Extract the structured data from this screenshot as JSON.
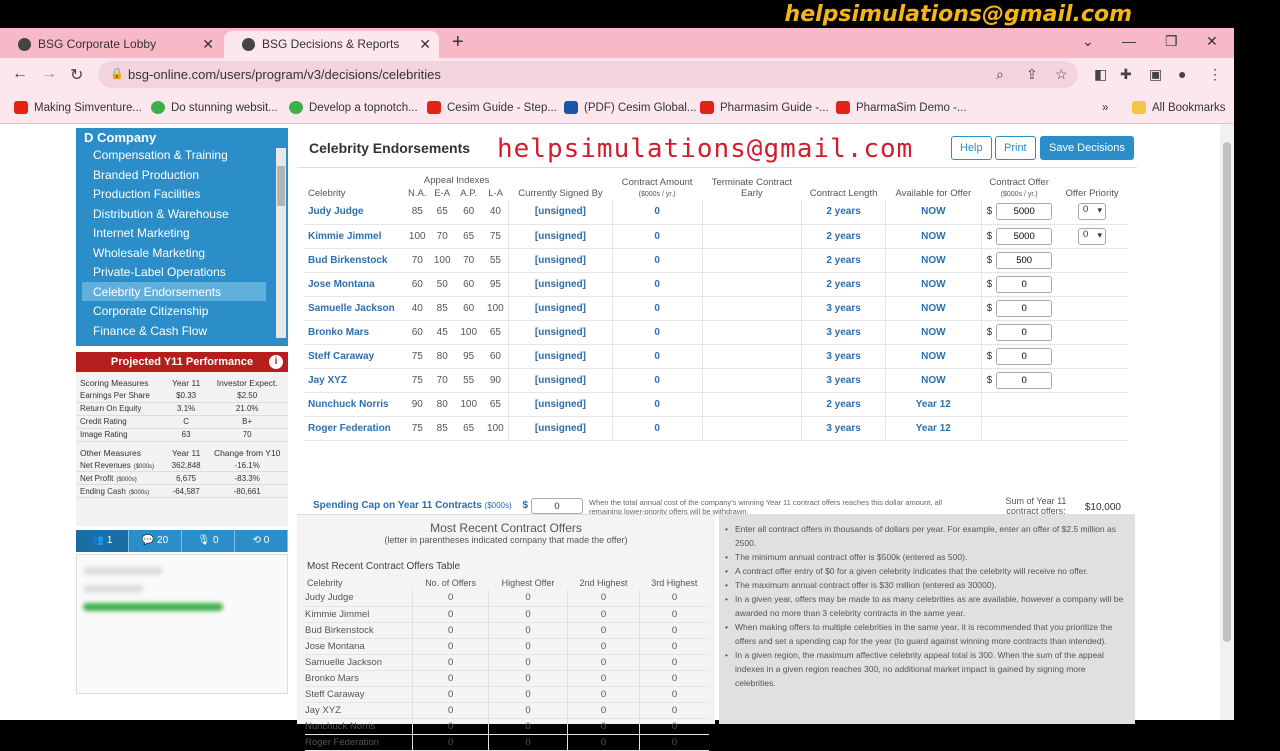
{
  "watermark_top": "helpsimulations@gmail.com",
  "watermark_mid": "helpsimulations@gmail.com",
  "browser": {
    "tabs": [
      {
        "title": "BSG Corporate Lobby"
      },
      {
        "title": "BSG Decisions & Reports"
      }
    ],
    "url": "bsg-online.com/users/program/v3/decisions/celebrities",
    "bookmarks": [
      {
        "label": "Making Simventure...",
        "icon": "youtube"
      },
      {
        "label": "Do stunning websit...",
        "icon": "green"
      },
      {
        "label": "Develop a topnotch...",
        "icon": "green"
      },
      {
        "label": "Cesim Guide - Step...",
        "icon": "youtube"
      },
      {
        "label": "(PDF) Cesim Global...",
        "icon": "doc"
      },
      {
        "label": "Pharmasim Guide -...",
        "icon": "youtube"
      },
      {
        "label": "PharmaSim Demo -...",
        "icon": "youtube"
      }
    ],
    "all_bookmarks": "All Bookmarks"
  },
  "sidebar": {
    "company": "D Company",
    "items": [
      "Compensation & Training",
      "Branded Production",
      "Production Facilities",
      "Distribution & Warehouse",
      "Internet Marketing",
      "Wholesale Marketing",
      "Private-Label Operations",
      "Celebrity Endorsements",
      "Corporate Citizenship",
      "Finance & Cash Flow"
    ],
    "active_index": 7
  },
  "performance": {
    "title": "Projected Y11 Performance",
    "scoring_header": [
      "Scoring Measures",
      "Year 11",
      "Investor Expect."
    ],
    "scoring": [
      [
        "Earnings Per Share",
        "$0.33",
        "$2.50"
      ],
      [
        "Return On Equity",
        "3.1%",
        "21.0%"
      ],
      [
        "Credit Rating",
        "C",
        "B+"
      ],
      [
        "Image Rating",
        "63",
        "70"
      ]
    ],
    "other_header": [
      "Other Measures",
      "Year 11",
      "Change from Y10"
    ],
    "other": [
      [
        "Net Revenues",
        "($000s)",
        "362,848",
        "-16.1%"
      ],
      [
        "Net Profit",
        "($000s)",
        "6,675",
        "-83.3%"
      ],
      [
        "Ending Cash",
        "($000s)",
        "-64,587",
        "-80,661"
      ]
    ]
  },
  "side_tabs": [
    "1",
    "20",
    "0",
    "0"
  ],
  "main": {
    "title": "Celebrity Endorsements",
    "buttons": {
      "help": "Help",
      "print": "Print",
      "save": "Save Decisions"
    },
    "headers": {
      "celebrity": "Celebrity",
      "appeal": "Appeal Indexes",
      "na": "N.A.",
      "ea": "E-A",
      "ap": "A.P.",
      "la": "L-A",
      "signed": "Currently Signed By",
      "contract_amount": "Contract Amount",
      "contract_amount_unit": "($000s / yr.)",
      "terminate": "Terminate Contract Early",
      "length": "Contract Length",
      "available": "Available for Offer",
      "offer": "Contract Offer",
      "offer_unit": "($000s / yr.)",
      "priority": "Offer Priority"
    },
    "celebrities": [
      {
        "name": "Judy Judge",
        "na": "85",
        "ea": "65",
        "ap": "60",
        "la": "40",
        "signed": "[unsigned]",
        "amount": "0",
        "length": "2 years",
        "available": "NOW",
        "offer": "5000",
        "priority": "0"
      },
      {
        "name": "Kimmie Jimmel",
        "na": "100",
        "ea": "70",
        "ap": "65",
        "la": "75",
        "signed": "[unsigned]",
        "amount": "0",
        "length": "2 years",
        "available": "NOW",
        "offer": "5000",
        "priority": "0"
      },
      {
        "name": "Bud Birkenstock",
        "na": "70",
        "ea": "100",
        "ap": "70",
        "la": "55",
        "signed": "[unsigned]",
        "amount": "0",
        "length": "2 years",
        "available": "NOW",
        "offer": "500",
        "priority": ""
      },
      {
        "name": "Jose Montana",
        "na": "60",
        "ea": "50",
        "ap": "60",
        "la": "95",
        "signed": "[unsigned]",
        "amount": "0",
        "length": "2 years",
        "available": "NOW",
        "offer": "0",
        "priority": ""
      },
      {
        "name": "Samuelle Jackson",
        "na": "40",
        "ea": "85",
        "ap": "60",
        "la": "100",
        "signed": "[unsigned]",
        "amount": "0",
        "length": "3 years",
        "available": "NOW",
        "offer": "0",
        "priority": ""
      },
      {
        "name": "Bronko Mars",
        "na": "60",
        "ea": "45",
        "ap": "100",
        "la": "65",
        "signed": "[unsigned]",
        "amount": "0",
        "length": "3 years",
        "available": "NOW",
        "offer": "0",
        "priority": ""
      },
      {
        "name": "Steff Caraway",
        "na": "75",
        "ea": "80",
        "ap": "95",
        "la": "60",
        "signed": "[unsigned]",
        "amount": "0",
        "length": "3 years",
        "available": "NOW",
        "offer": "0",
        "priority": ""
      },
      {
        "name": "Jay XYZ",
        "na": "75",
        "ea": "70",
        "ap": "55",
        "la": "90",
        "signed": "[unsigned]",
        "amount": "0",
        "length": "3 years",
        "available": "NOW",
        "offer": "0",
        "priority": ""
      },
      {
        "name": "Nunchuck Norris",
        "na": "90",
        "ea": "80",
        "ap": "100",
        "la": "65",
        "signed": "[unsigned]",
        "amount": "0",
        "length": "2 years",
        "available": "Year 12",
        "offer": "",
        "priority": ""
      },
      {
        "name": "Roger Federation",
        "na": "75",
        "ea": "85",
        "ap": "65",
        "la": "100",
        "signed": "[unsigned]",
        "amount": "0",
        "length": "3 years",
        "available": "Year 12",
        "offer": "",
        "priority": ""
      }
    ],
    "spending_cap": {
      "label": "Spending Cap on Year 11 Contracts",
      "unit": "($000s)",
      "currency": "$",
      "value": "0",
      "note": "When the total annual cost of the company's winning Year 11 contract offers reaches this dollar amount, all remaining lower-priority offers will be withdrawn.",
      "sum_label": "Sum of Year 11 contract offers:",
      "sum_value": "$10,000"
    },
    "recent": {
      "title": "Most Recent Contract Offers",
      "subtitle": "(letter in parentheses indicated company that made the offer)",
      "table_title": "Most Recent Contract Offers Table",
      "headers": [
        "Celebrity",
        "No. of Offers",
        "Highest Offer",
        "2nd Highest",
        "3rd Highest"
      ],
      "rows": [
        [
          "Judy Judge",
          "0",
          "0",
          "0",
          "0"
        ],
        [
          "Kimmie Jimmel",
          "0",
          "0",
          "0",
          "0"
        ],
        [
          "Bud Birkenstock",
          "0",
          "0",
          "0",
          "0"
        ],
        [
          "Jose Montana",
          "0",
          "0",
          "0",
          "0"
        ],
        [
          "Samuelle Jackson",
          "0",
          "0",
          "0",
          "0"
        ],
        [
          "Bronko Mars",
          "0",
          "0",
          "0",
          "0"
        ],
        [
          "Steff Caraway",
          "0",
          "0",
          "0",
          "0"
        ],
        [
          "Jay XYZ",
          "0",
          "0",
          "0",
          "0"
        ],
        [
          "Nunchuck Norris",
          "0",
          "0",
          "0",
          "0"
        ],
        [
          "Roger Federation",
          "0",
          "0",
          "0",
          "0"
        ]
      ]
    },
    "notes": [
      "Enter all contract offers in thousands of dollars per year. For example, enter an offer of $2.5 million as 2500.",
      "The minimum annual contract offer is $500k (entered as 500).",
      "A contract offer entry of $0 for a given celebrity indicates that the celebrity will receive no offer.",
      "The maximum annual contract offer is $30 million (entered as 30000).",
      "In a given year, offers may be made to as many celebrities as are available, however a company will be awarded no more than 3 celebrity contracts in the same year.",
      "When making offers to multiple celebrities in the same year, it is recommended that you prioritize the offers and set a spending cap for the year (to guard against winning more contracts than intended).",
      "In a given region, the maximum affective celebrity appeal total is 300. When the sum of the appeal indexes in a given region reaches 300, no additional market impact is gained by signing more celebrities."
    ]
  }
}
